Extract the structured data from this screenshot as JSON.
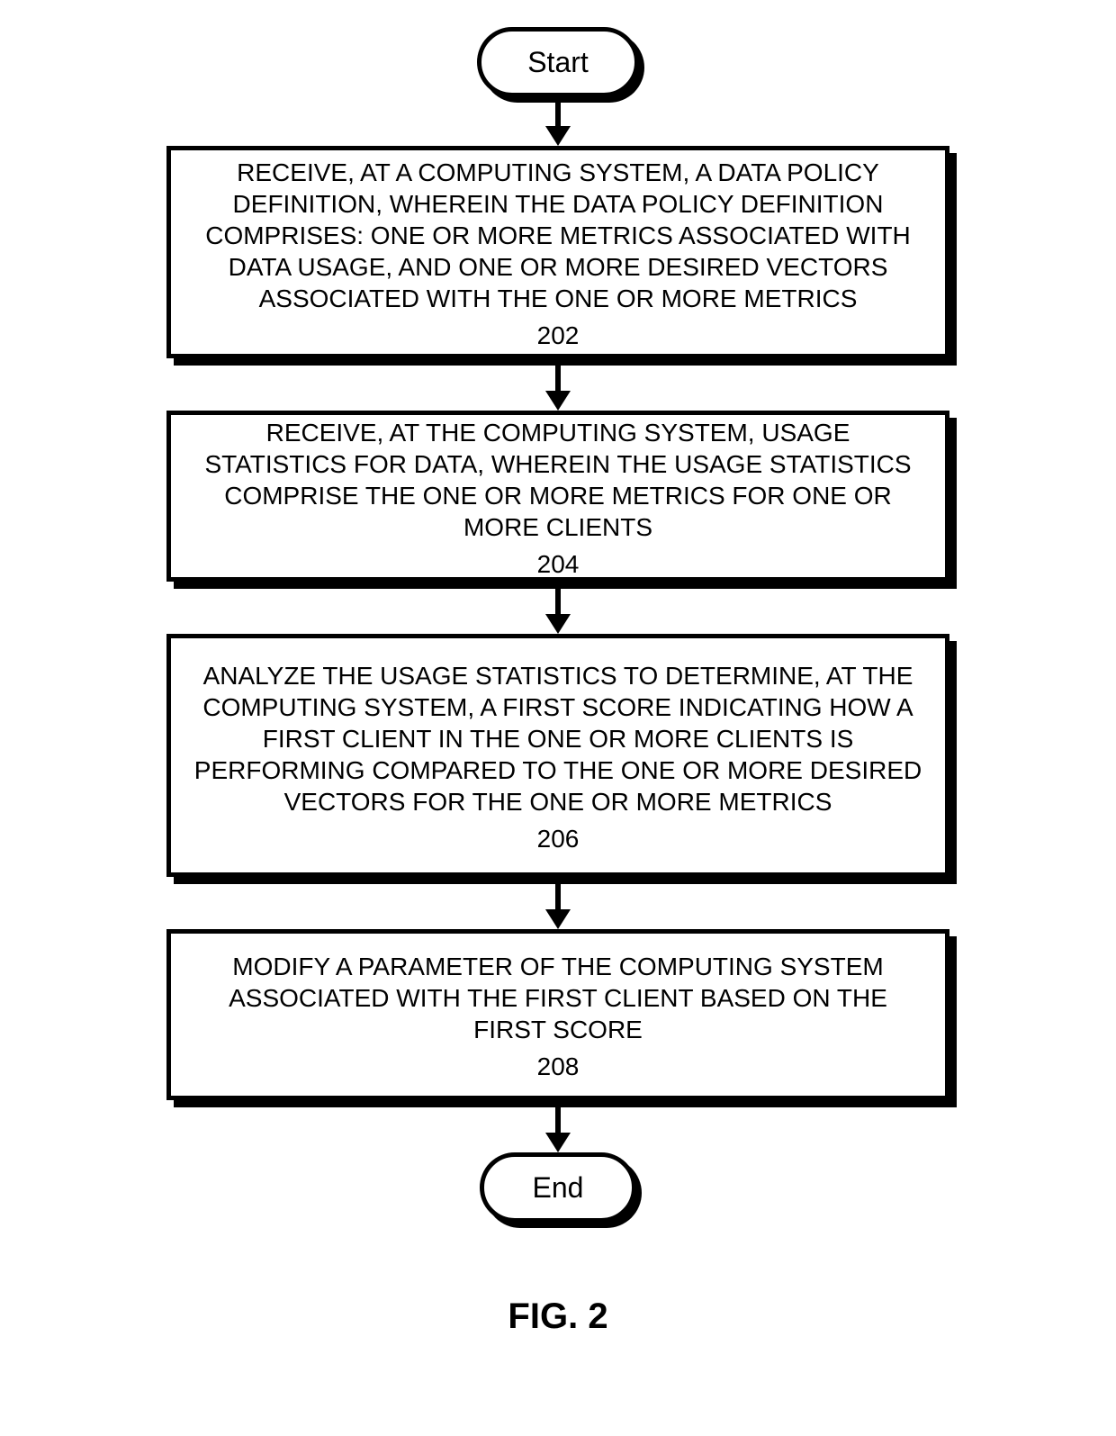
{
  "figure_label": "FIG. 2",
  "terminators": {
    "start": "Start",
    "end": "End"
  },
  "steps": [
    {
      "text": "RECEIVE, AT A COMPUTING SYSTEM, A DATA POLICY DEFINITION, WHEREIN THE DATA POLICY DEFINITION COMPRISES: ONE OR MORE METRICS ASSOCIATED WITH DATA USAGE, AND ONE OR MORE DESIRED VECTORS ASSOCIATED WITH THE ONE OR MORE METRICS",
      "ref": "202"
    },
    {
      "text": "RECEIVE, AT THE COMPUTING SYSTEM, USAGE STATISTICS FOR DATA, WHEREIN THE USAGE STATISTICS COMPRISE THE ONE OR MORE METRICS FOR ONE OR MORE CLIENTS",
      "ref": "204"
    },
    {
      "text": "ANALYZE THE USAGE STATISTICS TO DETERMINE, AT THE COMPUTING SYSTEM, A FIRST SCORE INDICATING HOW A FIRST CLIENT IN THE ONE OR MORE CLIENTS IS PERFORMING COMPARED TO THE ONE OR MORE DESIRED VECTORS FOR THE ONE OR MORE METRICS",
      "ref": "206"
    },
    {
      "text": "MODIFY A PARAMETER OF THE COMPUTING SYSTEM ASSOCIATED WITH THE FIRST CLIENT BASED ON THE FIRST SCORE",
      "ref": "208"
    }
  ]
}
